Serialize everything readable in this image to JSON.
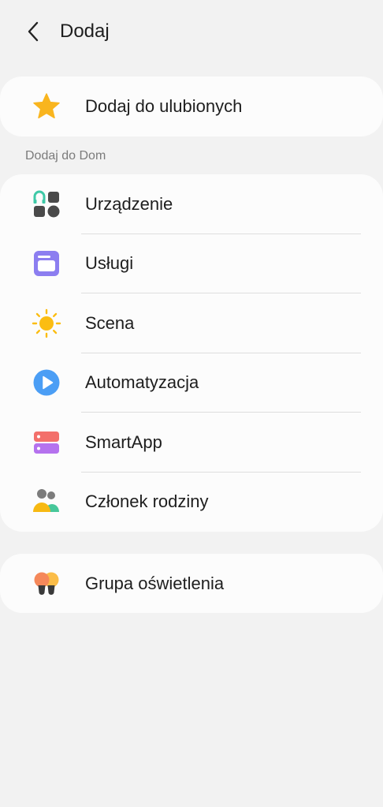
{
  "header": {
    "title": "Dodaj"
  },
  "favorites": {
    "label": "Dodaj do ulubionych"
  },
  "section": {
    "label": "Dodaj do Dom"
  },
  "home_items": [
    {
      "label": "Urządzenie",
      "icon": "device-grid-icon"
    },
    {
      "label": "Usługi",
      "icon": "services-icon"
    },
    {
      "label": "Scena",
      "icon": "scene-sun-icon"
    },
    {
      "label": "Automatyzacja",
      "icon": "automation-play-icon"
    },
    {
      "label": "SmartApp",
      "icon": "smartapp-icon"
    },
    {
      "label": "Członek rodziny",
      "icon": "family-member-icon"
    }
  ],
  "lighting": {
    "label": "Grupa oświetlenia"
  },
  "colors": {
    "background": "#f2f2f2",
    "card": "#fcfcfc",
    "star": "#f9b51e",
    "services": "#8c7ef0",
    "sun": "#fbbd12",
    "automation": "#4b9ef5",
    "smartapp_top": "#f3706b",
    "smartapp_bottom": "#b572ee"
  }
}
